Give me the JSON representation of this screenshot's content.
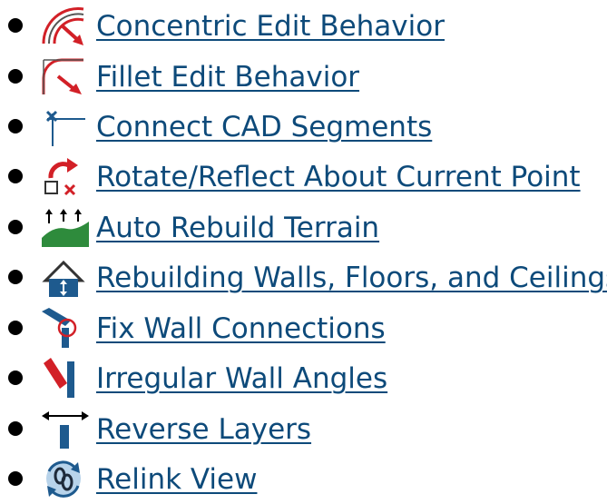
{
  "colors": {
    "link": "#0d4a7a",
    "bullet": "#000000",
    "icon_red": "#d22027",
    "icon_blue": "#1e5a8e",
    "icon_green": "#2e8b3c"
  },
  "items": [
    {
      "label": "Concentric Edit Behavior",
      "icon": "concentric-edit-icon"
    },
    {
      "label": "Fillet Edit Behavior",
      "icon": "fillet-edit-icon"
    },
    {
      "label": "Connect CAD Segments",
      "icon": "connect-segments-icon"
    },
    {
      "label": "Rotate/Reflect About Current Point",
      "icon": "rotate-reflect-icon"
    },
    {
      "label": "Auto Rebuild Terrain",
      "icon": "terrain-icon"
    },
    {
      "label": "Rebuilding Walls, Floors, and Ceilings",
      "icon": "house-rebuild-icon"
    },
    {
      "label": "Fix Wall Connections",
      "icon": "wall-connection-icon"
    },
    {
      "label": "Irregular Wall Angles",
      "icon": "wall-angle-icon"
    },
    {
      "label": "Reverse Layers",
      "icon": "reverse-layers-icon"
    },
    {
      "label": "Relink View",
      "icon": "relink-icon"
    }
  ]
}
